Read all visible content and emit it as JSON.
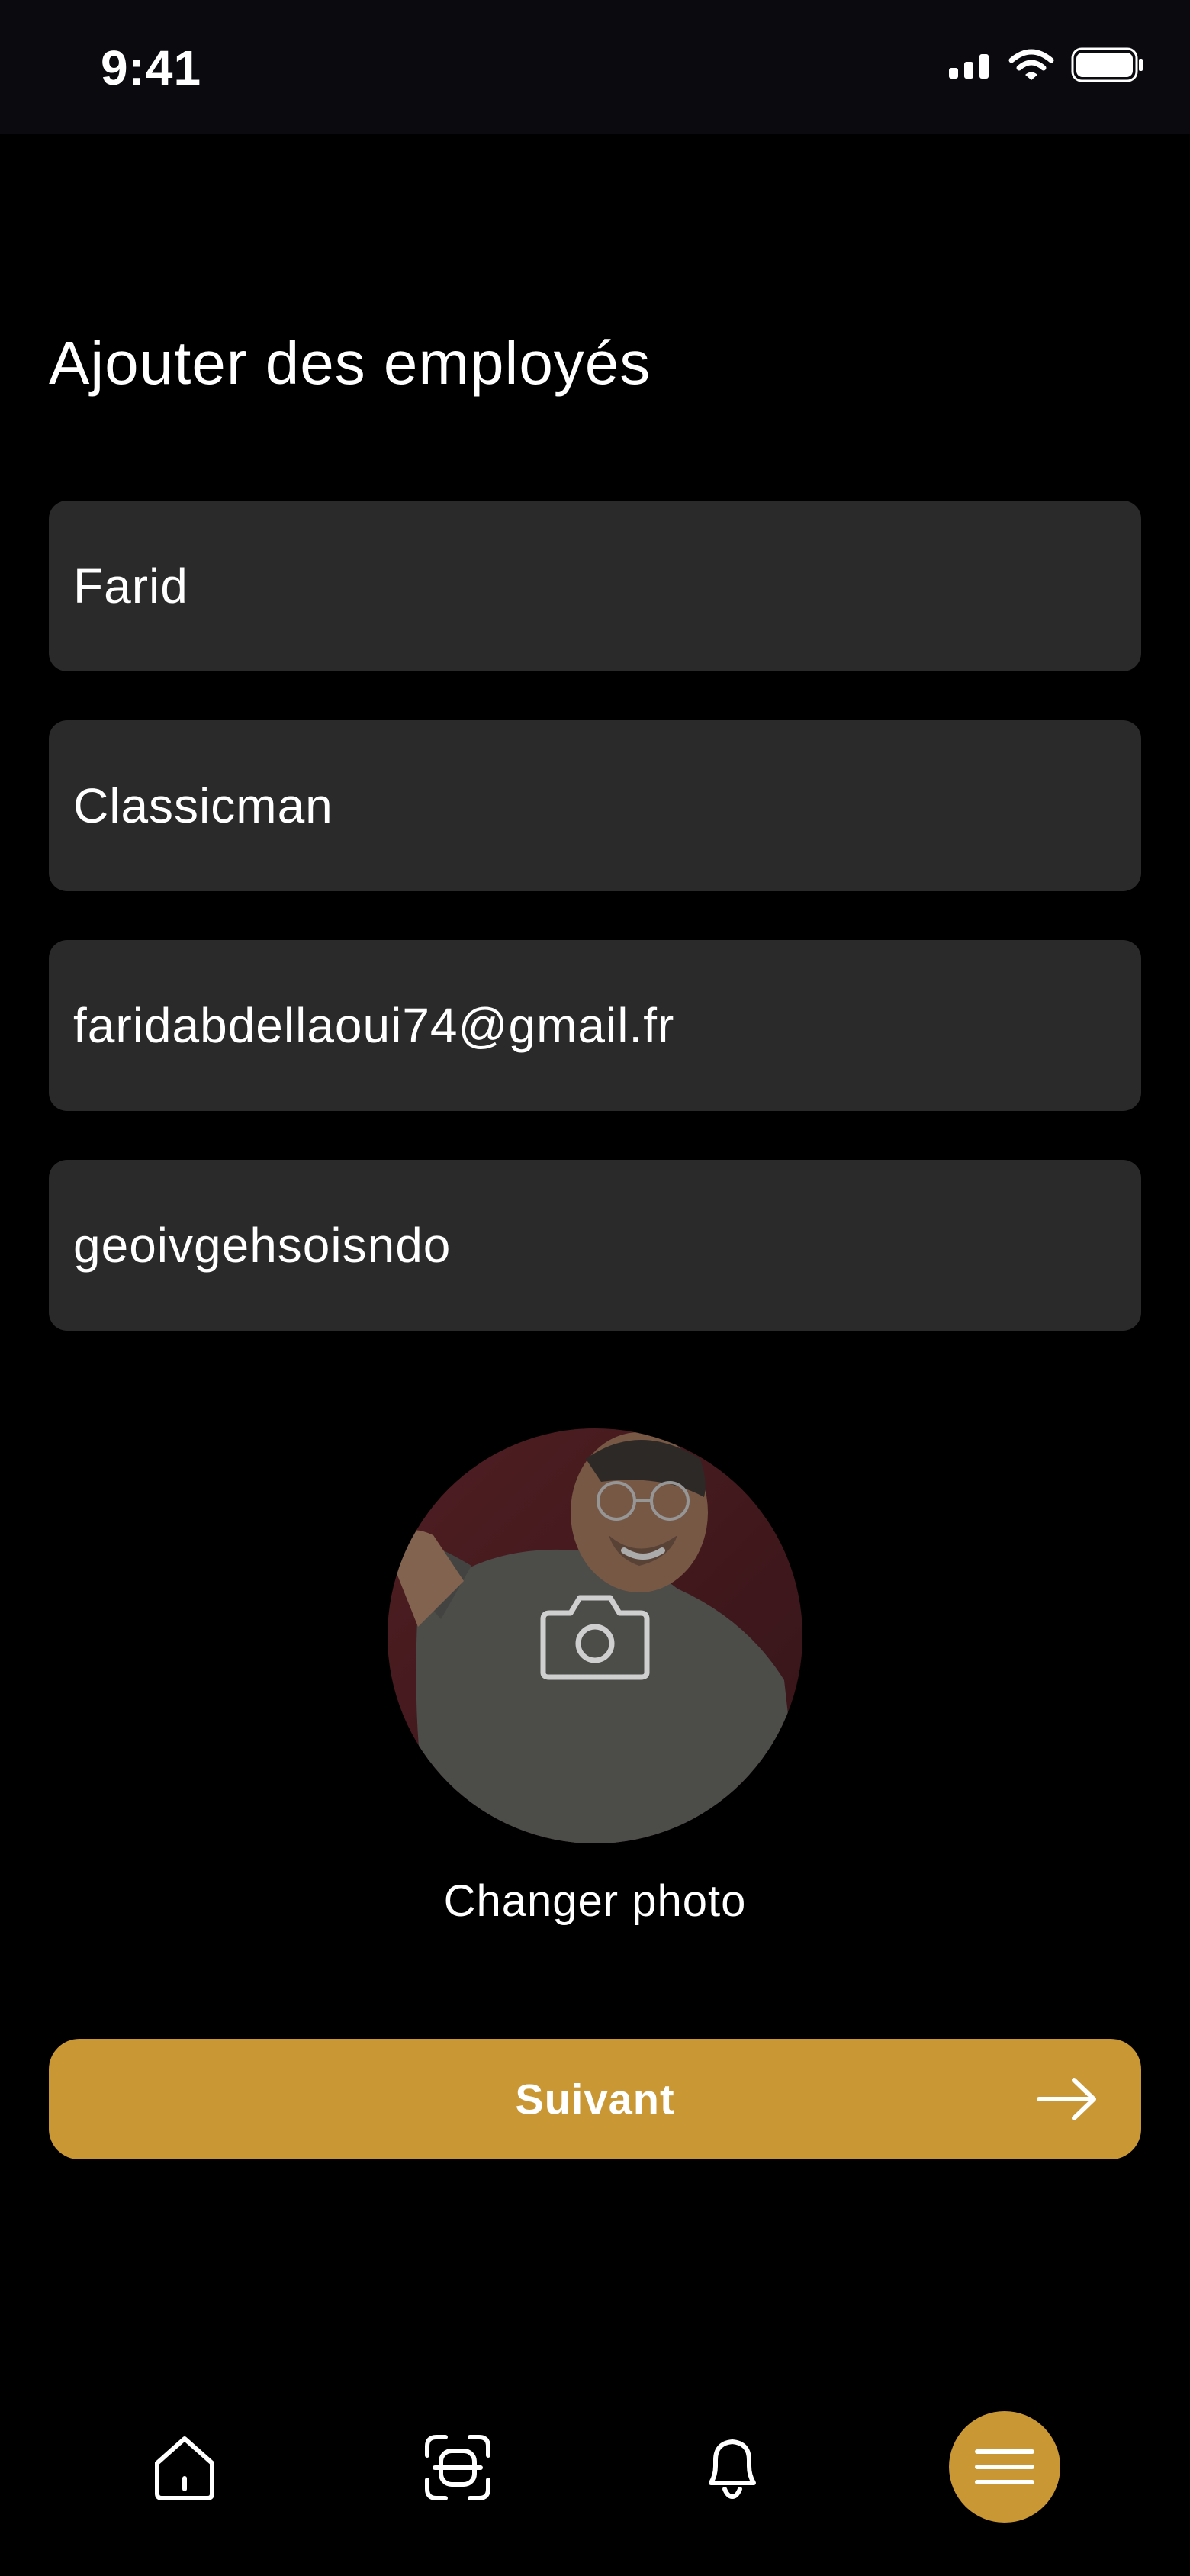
{
  "status_bar": {
    "time": "9:41"
  },
  "page": {
    "title": "Ajouter des employés"
  },
  "form": {
    "first_name": "Farid",
    "last_name": "Classicman",
    "email": "faridabdellaoui74@gmail.fr",
    "password": "geoivgehsoisndo"
  },
  "photo": {
    "change_label": "Changer photo"
  },
  "actions": {
    "next_label": "Suivant"
  },
  "bottom_nav": {
    "items": [
      "home-icon",
      "scan-icon",
      "bell-icon",
      "menu-icon"
    ]
  },
  "colors": {
    "accent": "#c99835",
    "field_background": "#2a2a2b",
    "background": "#000000"
  }
}
